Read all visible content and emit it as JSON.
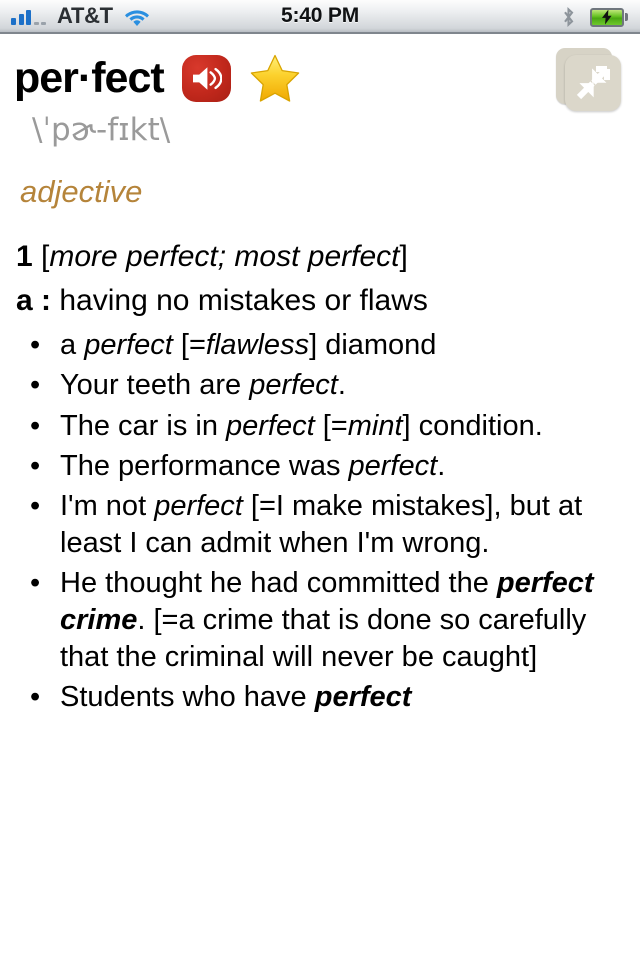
{
  "statusbar": {
    "carrier": "AT&T",
    "time": "5:40 PM",
    "signal_icon": "signal-bars-icon",
    "wifi_icon": "wifi-icon",
    "bluetooth_icon": "bluetooth-icon",
    "battery_icon": "battery-charging-icon",
    "signal_bars_filled": 3,
    "signal_bars_total": 5
  },
  "toolbar": {
    "collapse_icon": "collapse-arrows-icon",
    "collapse_label": "Collapse"
  },
  "entry": {
    "headword": "per·fect",
    "audio_icon": "speaker-icon",
    "favorite_icon": "star-icon",
    "pronunciation": "\\ˈpɚ-fɪkt\\",
    "part_of_speech": "adjective",
    "sense_number": "1",
    "inflections": "more perfect; most perfect",
    "subsense_letter": "a",
    "subsense_colon": ":",
    "definition": "having no mistakes or flaws",
    "examples": [
      [
        {
          "t": "a ",
          "s": "plain"
        },
        {
          "t": "perfect",
          "s": "italic"
        },
        {
          "t": " [=",
          "s": "plain"
        },
        {
          "t": "flawless",
          "s": "italic"
        },
        {
          "t": "] diamond",
          "s": "plain"
        }
      ],
      [
        {
          "t": "Your teeth are ",
          "s": "plain"
        },
        {
          "t": "perfect",
          "s": "italic"
        },
        {
          "t": ".",
          "s": "plain"
        }
      ],
      [
        {
          "t": "The car is in ",
          "s": "plain"
        },
        {
          "t": "perfect",
          "s": "italic"
        },
        {
          "t": " [=",
          "s": "plain"
        },
        {
          "t": "mint",
          "s": "italic"
        },
        {
          "t": "] condition.",
          "s": "plain"
        }
      ],
      [
        {
          "t": "The performance was ",
          "s": "plain"
        },
        {
          "t": "perfect",
          "s": "italic"
        },
        {
          "t": ".",
          "s": "plain"
        }
      ],
      [
        {
          "t": "I'm not ",
          "s": "plain"
        },
        {
          "t": "perfect",
          "s": "italic"
        },
        {
          "t": " [=I make mistakes], but at least I can admit when I'm wrong.",
          "s": "plain"
        }
      ],
      [
        {
          "t": "He thought he had committed the ",
          "s": "plain"
        },
        {
          "t": "perfect crime",
          "s": "bold"
        },
        {
          "t": ". [=a crime that is done so carefully that the criminal will never be caught]",
          "s": "plain"
        }
      ],
      [
        {
          "t": "Students who have ",
          "s": "plain"
        },
        {
          "t": "perfect",
          "s": "bold"
        }
      ]
    ]
  },
  "colors": {
    "accent_audio": "#c1281c",
    "star": "#f5c518",
    "part_of_speech": "#b5843a",
    "pronunciation": "#9a9a9a",
    "collapse_button": "#dbd7ca",
    "signal": "#1c70c8"
  }
}
